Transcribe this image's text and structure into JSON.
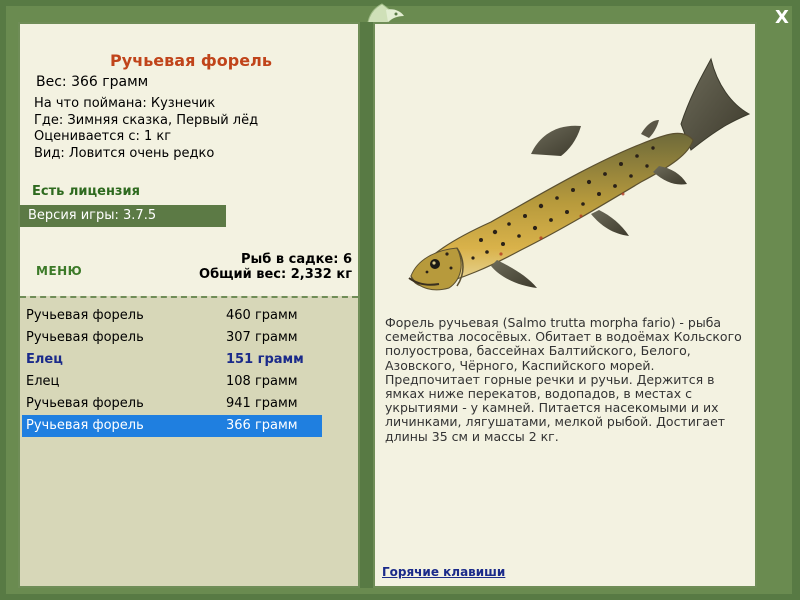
{
  "window": {
    "close_label": "X"
  },
  "fish": {
    "title": "Ручьевая форель",
    "weight_line": "Вес: 366 грамм",
    "caught_on": "На что поймана: Кузнечик",
    "where": "Где: Зимняя сказка, Первый лёд",
    "valued_from": "Оценивается с: 1 кг",
    "rarity": "Вид: Ловится очень редко"
  },
  "license": "Есть лицензия",
  "version": "Версия игры: 3.7.5",
  "menu_label": "МЕНЮ",
  "cage": {
    "count_line": "Рыб в садке: 6",
    "total_line": "Общий вес: 2,332 кг"
  },
  "catch_list": [
    {
      "name": "Ручьевая форель",
      "weight": "460 грамм",
      "style": "normal"
    },
    {
      "name": "Ручьевая форель",
      "weight": "307 грамм",
      "style": "normal"
    },
    {
      "name": "Елец",
      "weight": "151 грамм",
      "style": "bold"
    },
    {
      "name": "Елец",
      "weight": "108 грамм",
      "style": "normal"
    },
    {
      "name": "Ручьевая форель",
      "weight": "941 грамм",
      "style": "normal"
    },
    {
      "name": "Ручьевая форель",
      "weight": "366 грамм",
      "style": "selected"
    }
  ],
  "description": "Форель ручьевая (Salmo trutta morpha fario) - рыба семейства лососёвых. Обитает в водоёмах Кольского полуострова, бассейнах Балтийского, Белого, Азовского, Чёрного, Каспийского морей. Предпочитает горные речки и ручьи. Держится в ямках ниже перекатов, водопадов, в местах с укрытиями - у камней. Питается насекомыми и их личинками, лягушатами, мелкой рыбой. Достигает длины 35 см и массы 2 кг.",
  "hotkeys_label": "Горячие клавиши",
  "colors": {
    "frame": "#587a44",
    "panel": "#f3f2e1",
    "title": "#c0441a",
    "license": "#2e6a1f",
    "selected_row": "#1f7fe0",
    "link": "#1a2a8a"
  }
}
